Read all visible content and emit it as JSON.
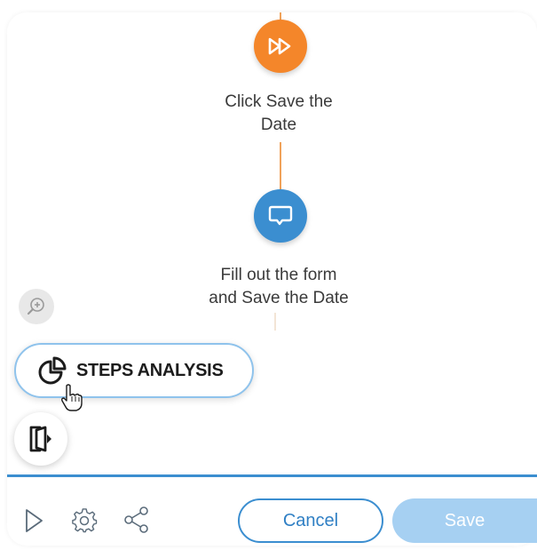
{
  "flow": {
    "nodes": [
      {
        "id": "save-the-date",
        "label_line1": "Click Save the",
        "label_line2": "Date",
        "color": "#f4862a",
        "icon": "fast-forward-icon"
      },
      {
        "id": "fill-form",
        "label_line1": "Fill out the form",
        "label_line2": "and Save the Date",
        "color": "#3b8ed0",
        "icon": "chat-bubble-icon"
      }
    ],
    "connector_color": "#f0a25a"
  },
  "side_tools": {
    "zoom_icon": "zoom-in-icon",
    "steps_analysis_label": "STEPS ANALYSIS",
    "steps_analysis_icon": "pie-chart-icon",
    "exit_icon": "exit-door-icon"
  },
  "footer": {
    "play_icon": "play-icon",
    "settings_icon": "gear-icon",
    "share_icon": "share-icon",
    "cancel_label": "Cancel",
    "save_label": "Save",
    "accent": "#3b8ed0",
    "save_disabled_color": "#a6d0f2"
  }
}
